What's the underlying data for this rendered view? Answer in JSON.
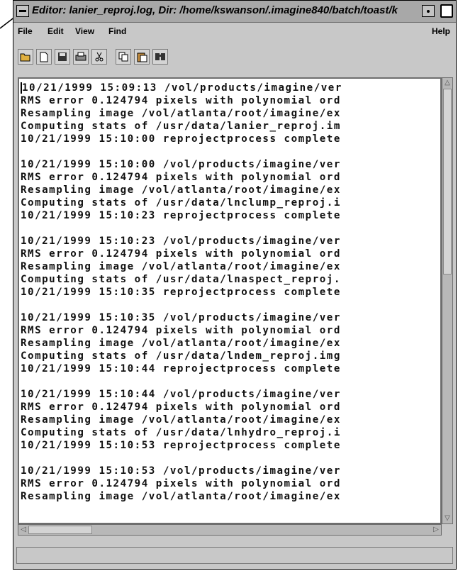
{
  "window": {
    "title": "Editor: lanier_reproj.log, Dir: /home/kswanson/.imagine840/batch/toast/k"
  },
  "menubar": {
    "file": "File",
    "edit": "Edit",
    "view": "View",
    "find": "Find",
    "help": "Help"
  },
  "toolbar": {
    "icons": [
      "open-folder-icon",
      "new-document-icon",
      "save-disk-icon",
      "print-icon",
      "cut-scissors-icon",
      "copy-icon",
      "paste-icon",
      "find-binoculars-icon"
    ]
  },
  "log_text": "10/21/1999 15:09:13 /vol/products/imagine/ver\nRMS error 0.124794 pixels with polynomial ord\nResampling image /vol/atlanta/root/imagine/ex\nComputing stats of /usr/data/lanier_reproj.im\n10/21/1999 15:10:00 reprojectprocess complete\n\n10/21/1999 15:10:00 /vol/products/imagine/ver\nRMS error 0.124794 pixels with polynomial ord\nResampling image /vol/atlanta/root/imagine/ex\nComputing stats of /usr/data/lnclump_reproj.i\n10/21/1999 15:10:23 reprojectprocess complete\n\n10/21/1999 15:10:23 /vol/products/imagine/ver\nRMS error 0.124794 pixels with polynomial ord\nResampling image /vol/atlanta/root/imagine/ex\nComputing stats of /usr/data/lnaspect_reproj.\n10/21/1999 15:10:35 reprojectprocess complete\n\n10/21/1999 15:10:35 /vol/products/imagine/ver\nRMS error 0.124794 pixels with polynomial ord\nResampling image /vol/atlanta/root/imagine/ex\nComputing stats of /usr/data/lndem_reproj.img\n10/21/1999 15:10:44 reprojectprocess complete\n\n10/21/1999 15:10:44 /vol/products/imagine/ver\nRMS error 0.124794 pixels with polynomial ord\nResampling image /vol/atlanta/root/imagine/ex\nComputing stats of /usr/data/lnhydro_reproj.i\n10/21/1999 15:10:53 reprojectprocess complete\n\n10/21/1999 15:10:53 /vol/products/imagine/ver\nRMS error 0.124794 pixels with polynomial ord\nResampling image /vol/atlanta/root/imagine/ex",
  "statusbar": {
    "text": ""
  }
}
